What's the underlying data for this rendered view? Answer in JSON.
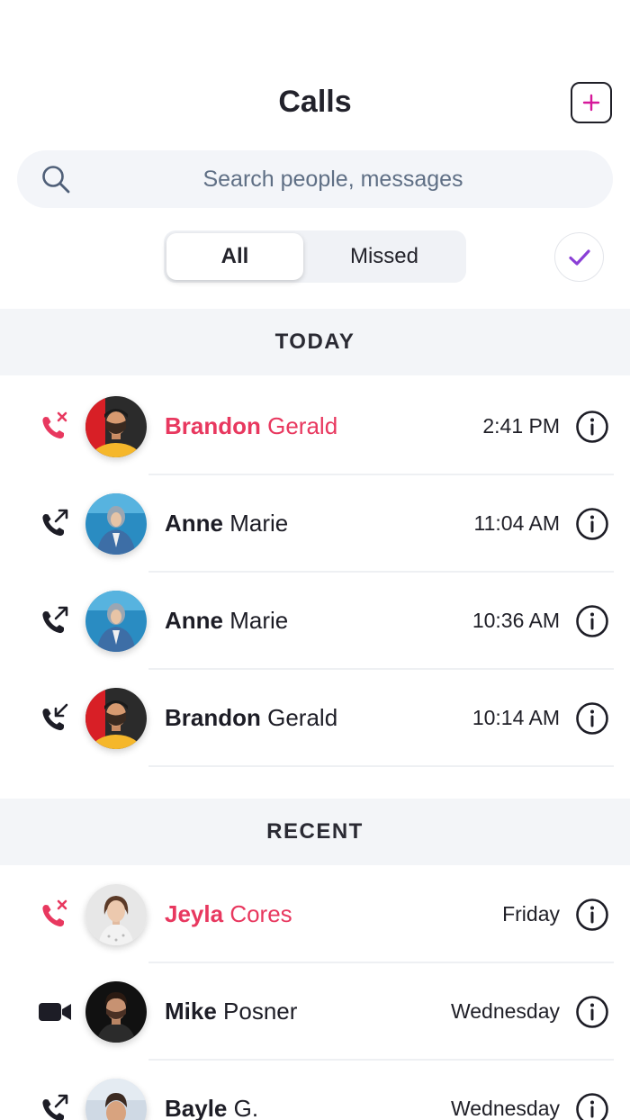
{
  "header": {
    "title": "Calls"
  },
  "search": {
    "placeholder": "Search people, messages"
  },
  "filter": {
    "options": [
      "All",
      "Missed"
    ],
    "selected": "All"
  },
  "sections": [
    {
      "label": "TODAY",
      "calls": [
        {
          "first": "Brandon",
          "last": "Gerald",
          "time": "2:41 PM",
          "type": "missed",
          "avatar": "brandon"
        },
        {
          "first": "Anne",
          "last": "Marie",
          "time": "11:04 AM",
          "type": "outgoing",
          "avatar": "anne"
        },
        {
          "first": "Anne",
          "last": "Marie",
          "time": "10:36 AM",
          "type": "outgoing",
          "avatar": "anne"
        },
        {
          "first": "Brandon",
          "last": "Gerald",
          "time": "10:14 AM",
          "type": "incoming",
          "avatar": "brandon"
        }
      ]
    },
    {
      "label": "RECENT",
      "calls": [
        {
          "first": "Jeyla",
          "last": "Cores",
          "time": "Friday",
          "type": "missed",
          "avatar": "jeyla"
        },
        {
          "first": "Mike",
          "last": "Posner",
          "time": "Wednesday",
          "type": "video",
          "avatar": "mike"
        },
        {
          "first": "Bayle",
          "last": "G.",
          "time": "Wednesday",
          "type": "outgoing",
          "avatar": "bayle"
        }
      ]
    }
  ],
  "colors": {
    "missed": "#e8385f",
    "accent": "#d6199a",
    "check": "#8a3fd6"
  },
  "icons": {
    "new_call": "plus-square-icon",
    "search": "search-icon",
    "select": "check-icon",
    "missed": "phone-missed-icon",
    "outgoing": "phone-outgoing-icon",
    "incoming": "phone-incoming-icon",
    "video": "video-camera-icon",
    "info": "info-circle-icon"
  }
}
